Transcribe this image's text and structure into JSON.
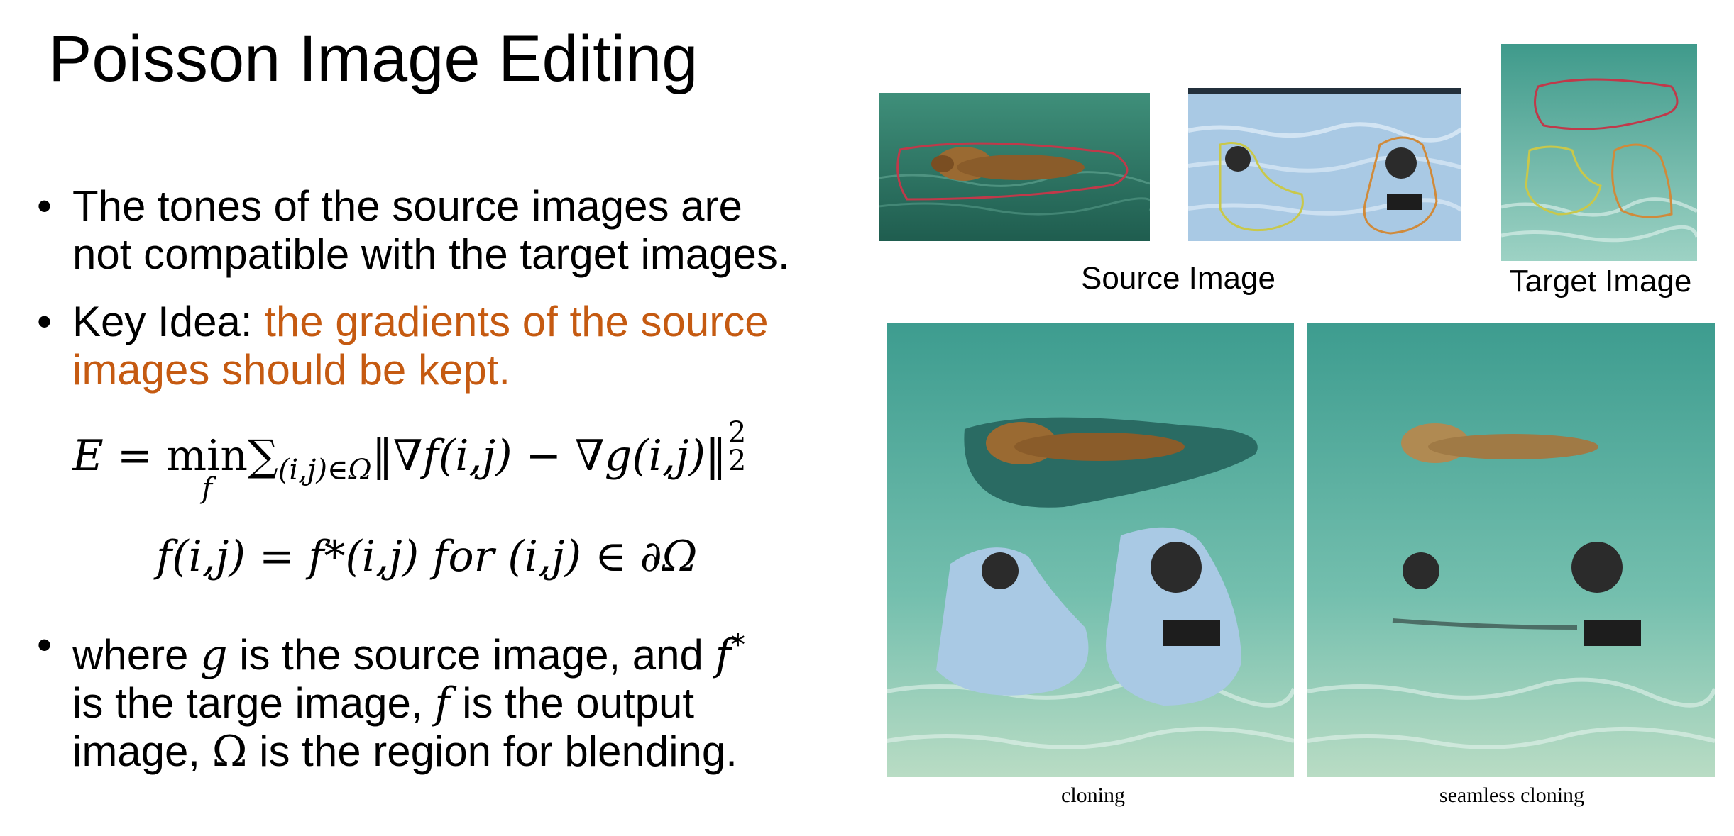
{
  "slide": {
    "title": "Poisson Image Editing",
    "bullets": [
      {
        "lines": [
          "The tones of the source images are",
          "not compatible with the target images."
        ]
      },
      {
        "prefix": "Key Idea: ",
        "accent_line1": "the gradients of the source",
        "accent_line2": "images should be kept."
      },
      {
        "l1_a": "where ",
        "l1_g": "g",
        "l1_b": " is the source image, and ",
        "l1_f": "f",
        "l1_star": "*",
        "l2_a": "is the targe image, ",
        "l2_f": "f",
        "l2_b": " is the output",
        "l3_a": "image, ",
        "l3_omega": "Ω",
        "l3_b": " is the region for blending."
      }
    ],
    "equations": {
      "energy": {
        "lhs": "E",
        "equals": " = ",
        "min": "min",
        "min_sub": "f",
        "sum": "∑",
        "sum_sub": "(i,j)∈Ω",
        "norm_body": "‖∇f(i,j) − ∇g(i,j)‖",
        "sub2": "2",
        "sup2": "2"
      },
      "boundary": {
        "text": "f(i,j) = f*(i,j)  for (i,j) ∈ ∂Ω"
      }
    },
    "captions": {
      "source": "Source Image",
      "target": "Target Image",
      "cloning": "cloning",
      "seamless": "seamless cloning"
    },
    "colors": {
      "accent": "#C55A11",
      "water_dark": "#2f7d6e",
      "water_light": "#7fc9bd",
      "pool_blue": "#a9c9e4",
      "outline_red": "#c0394a",
      "outline_yellow": "#c9c84a",
      "outline_orange": "#d08a3a"
    },
    "images": {
      "bear_photo": "bear-swimming-photo",
      "pool_photo": "swimmers-pool-photo",
      "target_photo": "target-water-photo",
      "cloning_photo": "cloning-result-photo",
      "seamless_photo": "seamless-cloning-result-photo"
    }
  }
}
